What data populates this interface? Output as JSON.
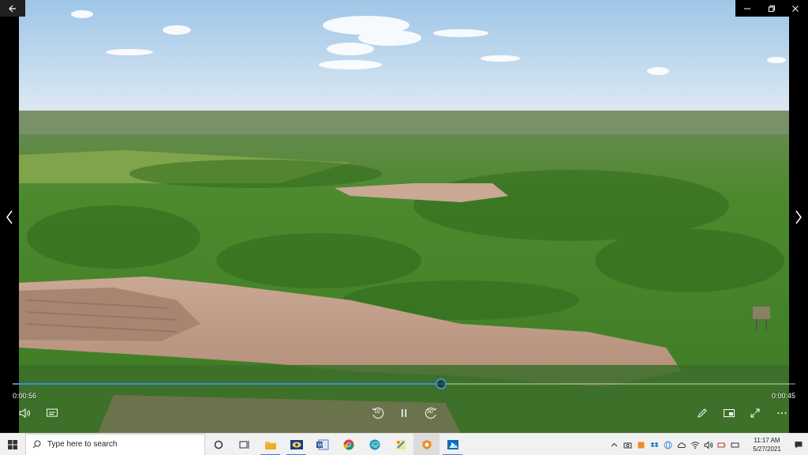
{
  "playback": {
    "elapsed": "0:00:56",
    "remaining": "0:00:45",
    "progress_fraction": 0.5475,
    "skip_back_seconds": "10",
    "skip_forward_seconds": "30"
  },
  "taskbar": {
    "search_placeholder": "Type here to search",
    "clock_time": "11:17 AM",
    "clock_date": "5/27/2021"
  },
  "colors": {
    "accent": "#3a8fd8",
    "taskbar_bg": "#f1f1f1"
  },
  "icons": {
    "title_bar": [
      "back-icon",
      "minimize-icon",
      "restore-icon",
      "close-icon"
    ],
    "controls": [
      "volume-icon",
      "subtitles-icon",
      "skip-back-icon",
      "pause-icon",
      "skip-forward-icon",
      "edit-pencil-icon",
      "mini-view-icon",
      "fullscreen-icon",
      "more-icon"
    ],
    "taskbar_apps": [
      "task-view-icon",
      "file-explorer-icon",
      "app-eye-icon",
      "word-icon",
      "chrome-icon",
      "edge-icon",
      "app-paint-icon",
      "app-vpn-icon",
      "photos-icon"
    ]
  }
}
